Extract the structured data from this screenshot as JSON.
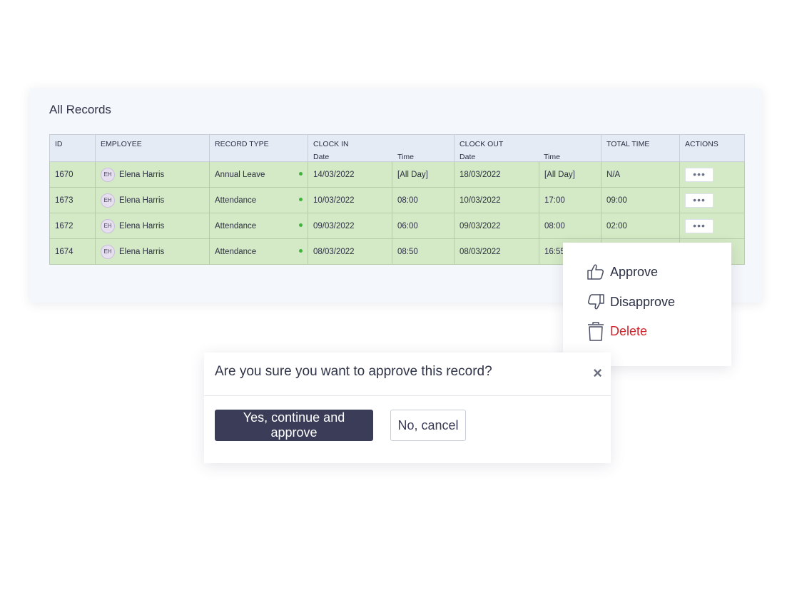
{
  "panel": {
    "title": "All Records",
    "columns": {
      "id": "ID",
      "employee": "EMPLOYEE",
      "record_type": "RECORD TYPE",
      "clock_in": "CLOCK IN",
      "clock_out": "CLOCK OUT",
      "total_time": "TOTAL TIME",
      "actions": "ACTIONS",
      "date": "Date",
      "time": "Time"
    },
    "rows": [
      {
        "id": "1670",
        "initials": "EH",
        "employee": "Elena Harris",
        "type": "Annual Leave",
        "in_date": "14/03/2022",
        "in_time": "[All Day]",
        "out_date": "18/03/2022",
        "out_time": "[All Day]",
        "total": "N/A",
        "actions": "•••"
      },
      {
        "id": "1673",
        "initials": "EH",
        "employee": "Elena Harris",
        "type": "Attendance",
        "in_date": "10/03/2022",
        "in_time": "08:00",
        "out_date": "10/03/2022",
        "out_time": "17:00",
        "total": "09:00",
        "actions": "•••"
      },
      {
        "id": "1672",
        "initials": "EH",
        "employee": "Elena Harris",
        "type": "Attendance",
        "in_date": "09/03/2022",
        "in_time": "06:00",
        "out_date": "09/03/2022",
        "out_time": "08:00",
        "total": "02:00",
        "actions": "•••"
      },
      {
        "id": "1674",
        "initials": "EH",
        "employee": "Elena Harris",
        "type": "Attendance",
        "in_date": "08/03/2022",
        "in_time": "08:50",
        "out_date": "08/03/2022",
        "out_time": "16:55",
        "total": "",
        "actions": ""
      }
    ]
  },
  "menu": {
    "approve": "Approve",
    "disapprove": "Disapprove",
    "delete": "Delete"
  },
  "dialog": {
    "title": "Are you sure you want to approve this record?",
    "close": "×",
    "confirm": "Yes, continue and approve",
    "cancel": "No, cancel"
  },
  "colors": {
    "row_background": "#d4e9c5",
    "status_dot": "#3db53d",
    "primary_button": "#3b3d58",
    "delete_text": "#d0232b"
  }
}
